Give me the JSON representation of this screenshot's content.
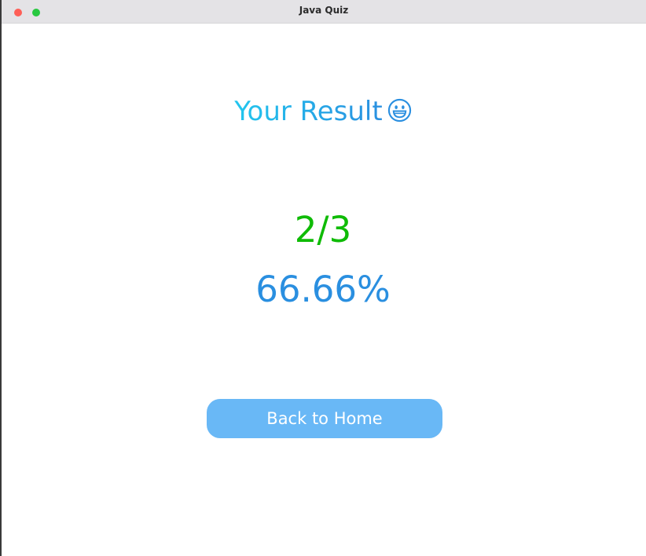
{
  "window": {
    "title": "Java Quiz"
  },
  "result": {
    "heading": "Your Result",
    "heading_icon": "grinning-face-icon",
    "score": "2/3",
    "percentage": "66.66%"
  },
  "actions": {
    "back_home_label": "Back to Home"
  },
  "colors": {
    "heading_gradient_start": "#22c6ee",
    "heading_gradient_end": "#2a8fe0",
    "score": "#0fbb06",
    "percentage": "#2a8fe0",
    "button_bg": "#69b8f6",
    "button_text": "#ffffff"
  }
}
